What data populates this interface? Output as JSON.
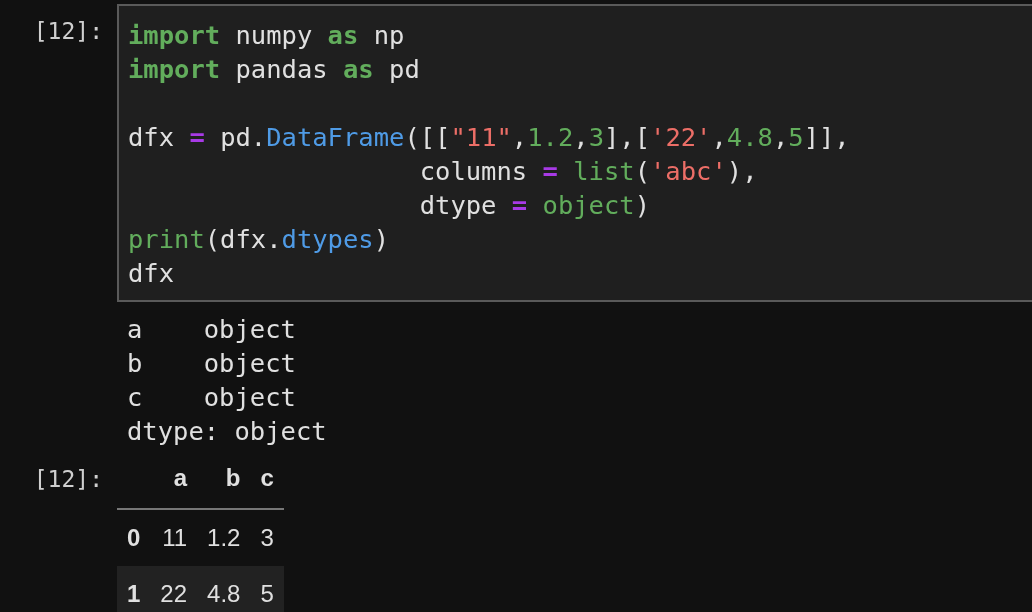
{
  "input_cell": {
    "prompt": "[12]:",
    "lines": [
      {
        "kind": "code",
        "tokens": [
          {
            "kind": "keyword",
            "text": "import"
          },
          {
            "kind": "plain",
            "text": " numpy "
          },
          {
            "kind": "keyword",
            "text": "as"
          },
          {
            "kind": "plain",
            "text": " np"
          }
        ]
      },
      {
        "kind": "code",
        "tokens": [
          {
            "kind": "keyword",
            "text": "import"
          },
          {
            "kind": "plain",
            "text": " pandas "
          },
          {
            "kind": "keyword",
            "text": "as"
          },
          {
            "kind": "plain",
            "text": " pd"
          }
        ]
      },
      {
        "kind": "blank"
      },
      {
        "kind": "code",
        "tokens": [
          {
            "kind": "plain",
            "text": "dfx "
          },
          {
            "kind": "operator",
            "text": "="
          },
          {
            "kind": "plain",
            "text": " pd."
          },
          {
            "kind": "function",
            "text": "DataFrame"
          },
          {
            "kind": "plain",
            "text": "([["
          },
          {
            "kind": "string",
            "text": "\"11\""
          },
          {
            "kind": "plain",
            "text": ","
          },
          {
            "kind": "number",
            "text": "1.2"
          },
          {
            "kind": "plain",
            "text": ","
          },
          {
            "kind": "number",
            "text": "3"
          },
          {
            "kind": "plain",
            "text": "],["
          },
          {
            "kind": "string",
            "text": "'22'"
          },
          {
            "kind": "plain",
            "text": ","
          },
          {
            "kind": "number",
            "text": "4.8"
          },
          {
            "kind": "plain",
            "text": ","
          },
          {
            "kind": "number",
            "text": "5"
          },
          {
            "kind": "plain",
            "text": "]],"
          }
        ]
      },
      {
        "kind": "code",
        "tokens": [
          {
            "kind": "plain",
            "text": "                   columns "
          },
          {
            "kind": "operator",
            "text": "= "
          },
          {
            "kind": "builtin",
            "text": "list"
          },
          {
            "kind": "plain",
            "text": "("
          },
          {
            "kind": "string",
            "text": "'abc'"
          },
          {
            "kind": "plain",
            "text": "),"
          }
        ]
      },
      {
        "kind": "code",
        "tokens": [
          {
            "kind": "plain",
            "text": "                   dtype "
          },
          {
            "kind": "operator",
            "text": "= "
          },
          {
            "kind": "builtin",
            "text": "object"
          },
          {
            "kind": "plain",
            "text": ")"
          }
        ]
      },
      {
        "kind": "code",
        "tokens": [
          {
            "kind": "builtin",
            "text": "print"
          },
          {
            "kind": "plain",
            "text": "(dfx."
          },
          {
            "kind": "function",
            "text": "dtypes"
          },
          {
            "kind": "plain",
            "text": ")"
          }
        ]
      },
      {
        "kind": "code",
        "tokens": [
          {
            "kind": "plain",
            "text": "dfx"
          }
        ]
      }
    ]
  },
  "stdout": [
    "a    object",
    "b    object",
    "c    object",
    "dtype: object"
  ],
  "output_cell": {
    "prompt": "[12]:",
    "table": {
      "columns": [
        "a",
        "b",
        "c"
      ],
      "rows": [
        {
          "index": "0",
          "cells": [
            "11",
            "1.2",
            "3"
          ]
        },
        {
          "index": "1",
          "cells": [
            "22",
            "4.8",
            "5"
          ]
        }
      ]
    }
  }
}
